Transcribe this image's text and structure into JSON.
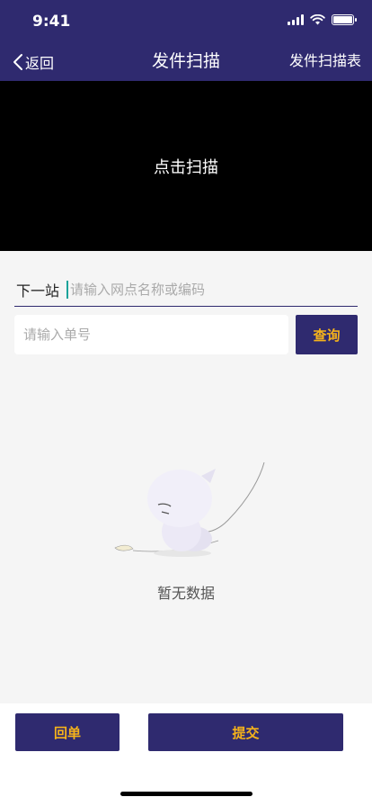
{
  "status_bar": {
    "time": "9:41"
  },
  "nav": {
    "back_label": "返回",
    "title": "发件扫描",
    "right_label": "发件扫描表"
  },
  "scan": {
    "label": "点击扫描"
  },
  "next_station": {
    "label": "下一站",
    "placeholder": "请输入网点名称或编码",
    "value": ""
  },
  "order_search": {
    "placeholder": "请输入单号",
    "value": "",
    "query_label": "查询"
  },
  "empty_state": {
    "text": "暂无数据"
  },
  "actions": {
    "return_label": "回单",
    "submit_label": "提交"
  },
  "colors": {
    "brand": "#2f2a6f",
    "accent": "#f5b21b",
    "cursor": "#1aa39a",
    "background": "#f5f5f5"
  }
}
